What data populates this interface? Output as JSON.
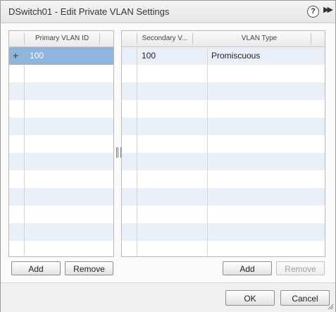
{
  "dialog": {
    "title": "DSwitch01 - Edit Private VLAN Settings",
    "help_glyph": "?",
    "expand_glyph": "▶▶"
  },
  "primary_table": {
    "columns": [
      "Primary VLAN ID"
    ],
    "rows": [
      {
        "expand_glyph": "+",
        "vlan_id": "100",
        "selected": true
      }
    ],
    "add_label": "Add",
    "remove_label": "Remove"
  },
  "secondary_table": {
    "columns": [
      "Secondary V...",
      "VLAN Type"
    ],
    "rows": [
      {
        "vlan_id": "100",
        "vlan_type": "Promiscuous"
      }
    ],
    "add_label": "Add",
    "remove_label": "Remove",
    "remove_disabled": true
  },
  "footer": {
    "ok_label": "OK",
    "cancel_label": "Cancel"
  },
  "colors": {
    "selected_row": "#8fb5dd",
    "alt_row": "#e9f0f8"
  }
}
